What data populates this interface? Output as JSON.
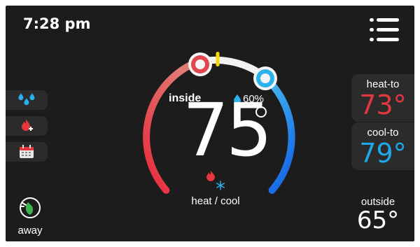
{
  "status": {
    "time": "7:28 pm"
  },
  "menu": {
    "icon": "hamburger-menu-icon"
  },
  "sidebar": {
    "items": [
      {
        "name": "humidity",
        "icon": "water-drops-icon"
      },
      {
        "name": "heat-boost",
        "icon": "flame-plus-icon"
      },
      {
        "name": "schedule",
        "icon": "calendar-icon"
      }
    ]
  },
  "away": {
    "label": "away",
    "icon": "leaf-power-icon"
  },
  "dial": {
    "inside_label": "inside",
    "humidity": "60%",
    "temperature": "75",
    "mode_label": "heat / cool",
    "heat_setpoint_icon": "heat-setpoint-knob",
    "cool_setpoint_icon": "cool-setpoint-knob"
  },
  "heat_to": {
    "label": "heat-to",
    "value": "73°",
    "color": "#e0383e"
  },
  "cool_to": {
    "label": "cool-to",
    "value": "79°",
    "color": "#1fa8e8"
  },
  "outside": {
    "label": "outside",
    "value": "65°"
  },
  "colors": {
    "background": "#1c1c1c",
    "panel": "#2b2b2b",
    "heat": "#e0383e",
    "cool": "#1fa8e8",
    "marker": "#f5d90a"
  }
}
